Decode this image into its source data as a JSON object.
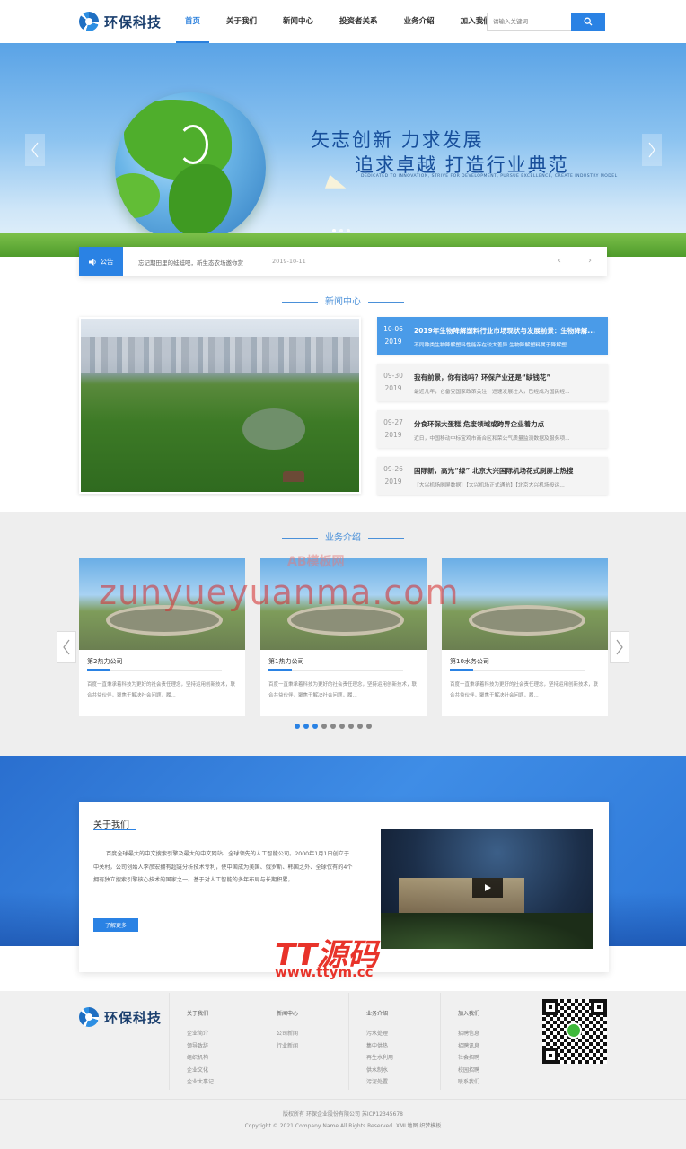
{
  "header": {
    "logo_text": "环保科技",
    "nav": [
      {
        "label": "首页",
        "active": true
      },
      {
        "label": "关于我们",
        "active": false
      },
      {
        "label": "新闻中心",
        "active": false
      },
      {
        "label": "投资者关系",
        "active": false
      },
      {
        "label": "业务介绍",
        "active": false
      },
      {
        "label": "加入我们",
        "active": false
      }
    ],
    "search_placeholder": "请输入关键词"
  },
  "banner": {
    "slogan_line1": "矢志创新  力求发展",
    "slogan_line2": "追求卓越  打造行业典范",
    "slogan_sub": "DEDICATED TO INNOVATION, STRIVE FOR DEVELOPMENT, PURSUE EXCELLENCE, CREATE INDUSTRY MODEL",
    "slide_count": 3,
    "active_slide": 1
  },
  "notice": {
    "label": "公告",
    "text": "忘记期田里的蛙蛙吧，新生态农场邀你赏",
    "date": "2019-10-11",
    "prev": "‹",
    "next": "›"
  },
  "news": {
    "section_title": "新闻中心",
    "items": [
      {
        "day": "10-06",
        "year": "2019",
        "title": "2019年生物降解塑料行业市场现状与发展前景：生物降解...",
        "desc": "不同种类生物降解塑料性能存在较大差异 生物降解塑料属于降解塑...",
        "active": true
      },
      {
        "day": "09-30",
        "year": "2019",
        "title": "我有前景，你有钱吗？环保产业还是“缺钱花”",
        "desc": "最近几年，它备受国家政策关注，迅速发展壮大，已经成为国民经...",
        "active": false
      },
      {
        "day": "09-27",
        "year": "2019",
        "title": "分食环保大蛋糕 危废领域或跨界企业着力点",
        "desc": "近日，中国移动中标宝鸡市商合区和荣公气质量监测数据及服务项...",
        "active": false
      },
      {
        "day": "09-26",
        "year": "2019",
        "title": "国际新，高光“绿” 北京大兴国际机场花式刷屏上热搜",
        "desc": "【大兴机场刷屏数据】【大兴机场正式通航】【北京大兴机场投运...",
        "active": false
      }
    ]
  },
  "business": {
    "section_title": "业务介绍",
    "cards": [
      {
        "title": "第2热力公司",
        "desc": "百度一直秉承着科技为更好的社会责任理念，坚持运用创新技术，联合共益伙伴，聚焦于解决社会问题，履..."
      },
      {
        "title": "第1热力公司",
        "desc": "百度一直秉承着科技为更好的社会责任理念，坚持运用创新技术，联合共益伙伴，聚焦于解决社会问题，履..."
      },
      {
        "title": "第10水务公司",
        "desc": "百度一直秉承着科技为更好的社会责任理念，坚持运用创新技术，联合共益伙伴，聚焦于解决社会问题，履..."
      }
    ],
    "page_count": 9,
    "active_page": 2,
    "watermark": "zunyueyuanma.com",
    "watermark_badge": "AB模板网"
  },
  "about": {
    "title": "关于我们",
    "text": "百度全球最大的中文搜索引擎及最大的中文网站、全球领先的人工智能公司。2000年1月1日创立于中关村，公司创始人李彦宏拥有超链分析技术专利，使中国成为美国、俄罗斯、韩国之外、全球仅有的4个拥有独立搜索引擎核心技术的国家之一。基于对人工智能的多年布局与长期积累，...",
    "button": "了解更多"
  },
  "overlay": {
    "logo": "TT源码",
    "url": "www.ttym.cc"
  },
  "footer": {
    "logo_text": "环保科技",
    "columns": [
      {
        "title": "关于我们",
        "links": [
          "企业简介",
          "领导致辞",
          "组织机构",
          "企业文化",
          "企业大事记"
        ]
      },
      {
        "title": "新闻中心",
        "links": [
          "公司新闻",
          "行业新闻"
        ]
      },
      {
        "title": "业务介绍",
        "links": [
          "污水处理",
          "集中供热",
          "再生水利用",
          "供水制水",
          "污泥处置"
        ]
      },
      {
        "title": "加入我们",
        "links": [
          "招聘信息",
          "招聘讯息",
          "社会招聘",
          "校园招聘",
          "联系我们"
        ]
      }
    ],
    "copyright_line1": "版权所有 环保企业股份有限公司 苏ICP12345678",
    "copyright_line2": "Copyright © 2021 Company Name,All Rights Reserved. XML地图 织梦模板"
  }
}
